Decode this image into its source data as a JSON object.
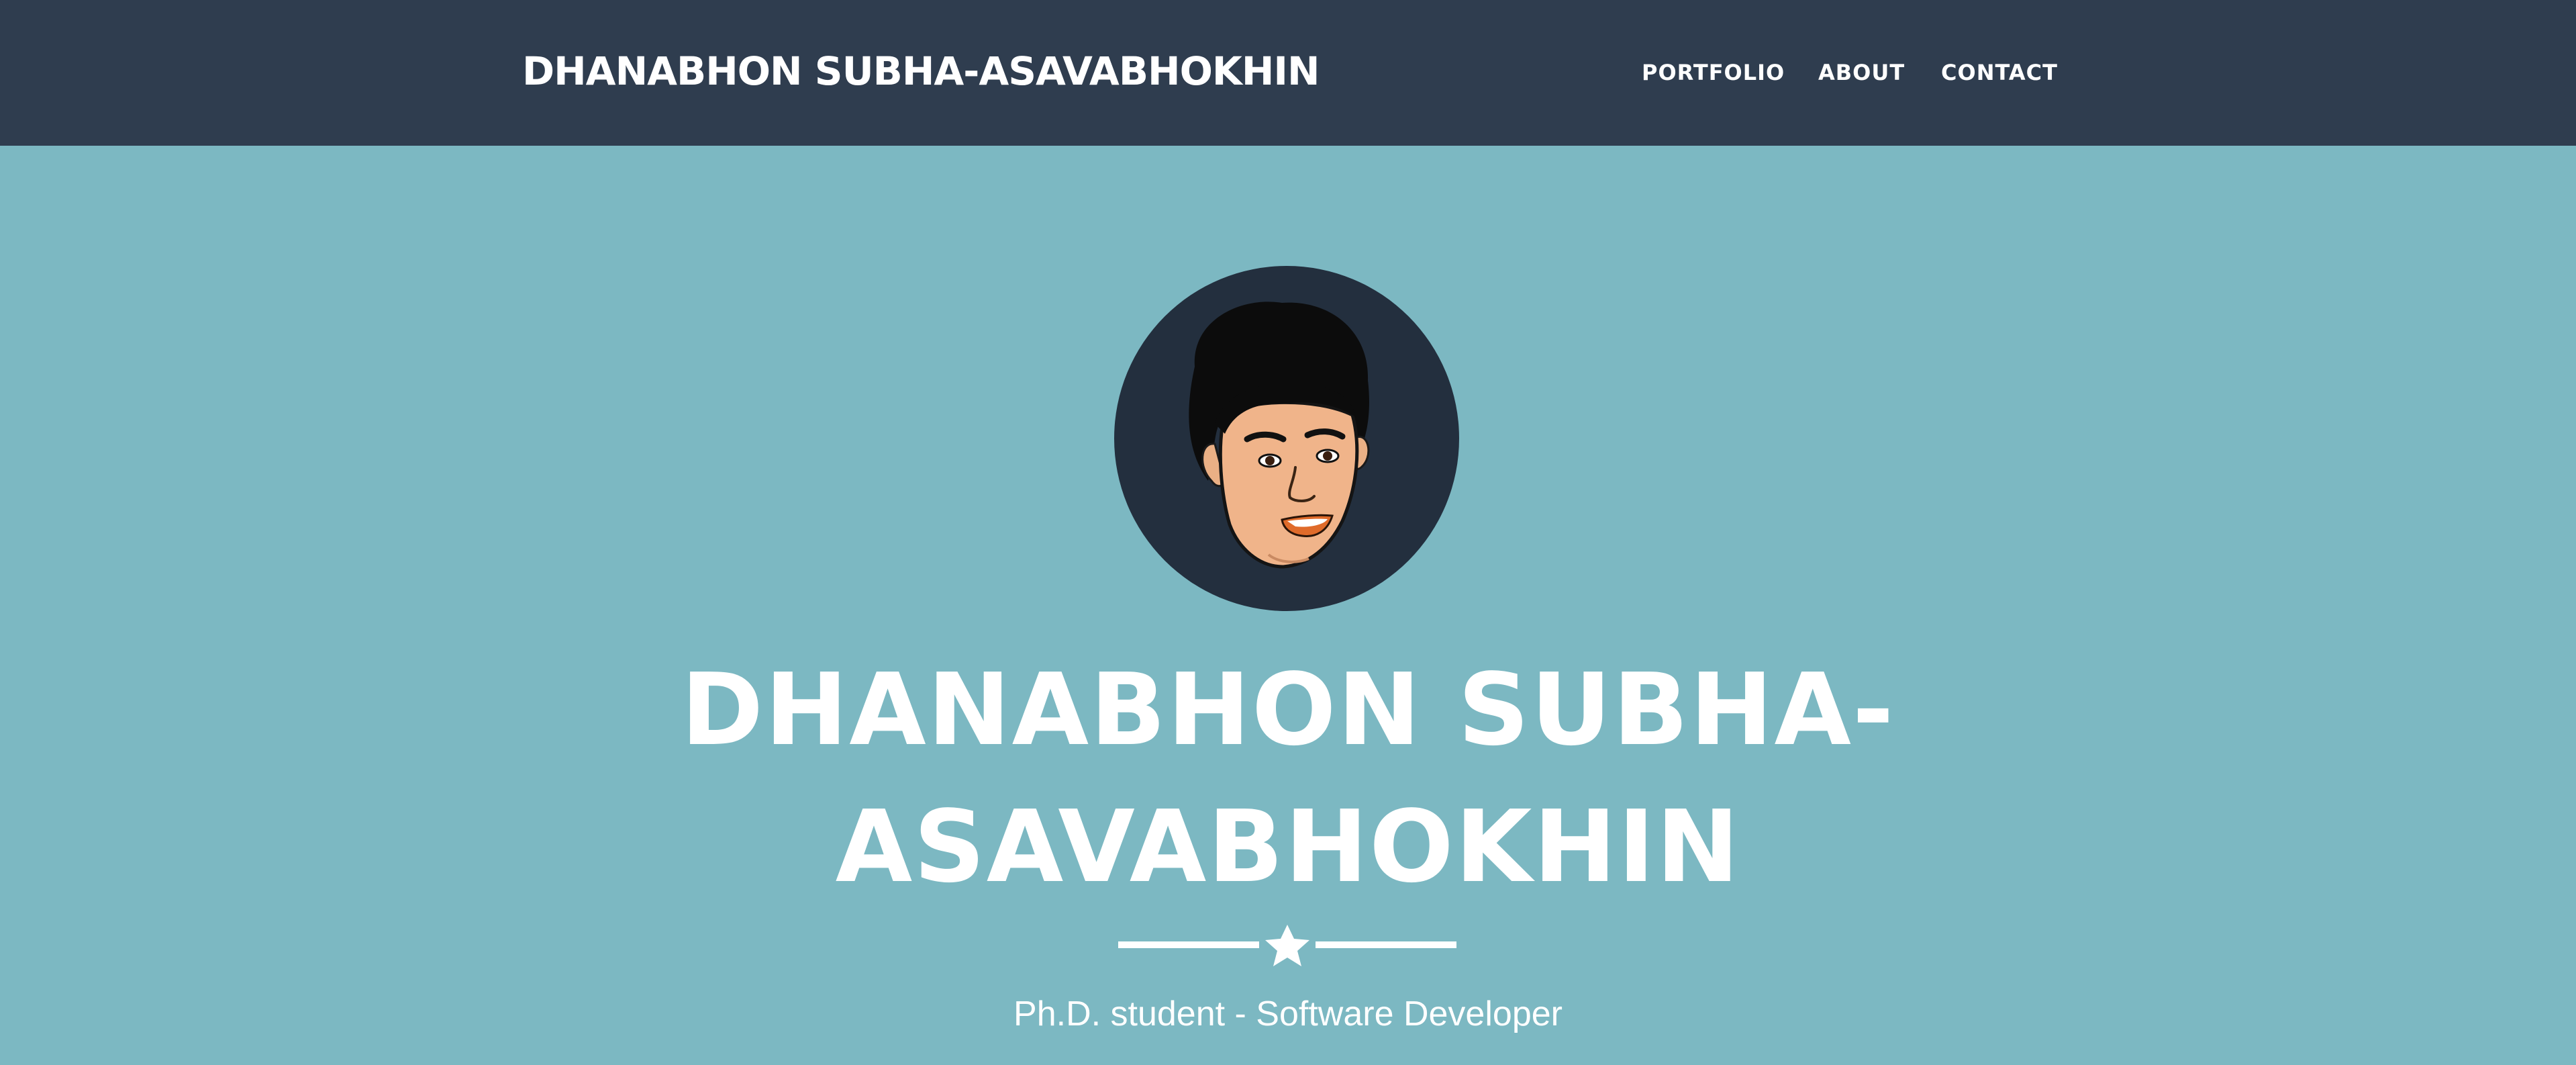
{
  "navbar": {
    "brand": "DHANABHON SUBHA-ASAVABHOKHIN",
    "links": [
      "PORTFOLIO",
      "ABOUT",
      "CONTACT"
    ]
  },
  "hero": {
    "title_line1": "DHANABHON SUBHA-",
    "title_line2": "ASAVABHOKHIN",
    "subtitle": "Ph.D. student - Software Developer",
    "avatar_icon": "cartoon-face-avatar",
    "divider_icon": "star-icon"
  },
  "colors": {
    "navbar_bg": "#2f3d4f",
    "hero_bg": "#7cb8c2",
    "avatar_bg": "#232f3e",
    "text": "#ffffff"
  }
}
